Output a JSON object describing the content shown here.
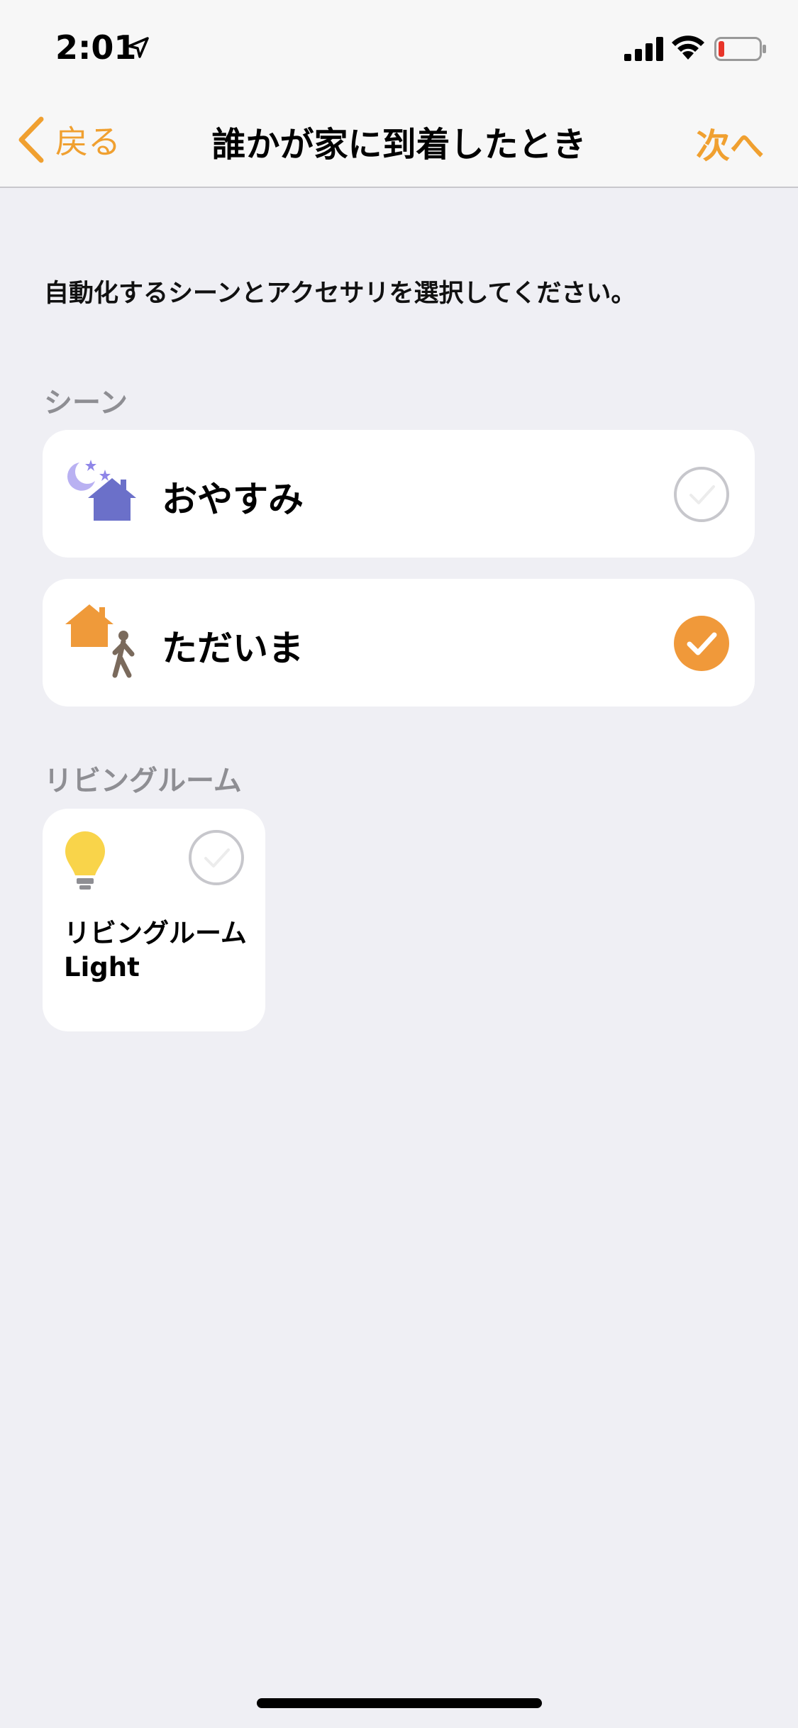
{
  "status_bar": {
    "time": "2:01",
    "icons": [
      "location-arrow-icon",
      "cellular-signal-icon",
      "wifi-icon",
      "battery-low-icon"
    ]
  },
  "nav": {
    "back_label": "戻る",
    "title": "誰かが家に到着したとき",
    "next_label": "次へ",
    "accent_color": "#f0a030"
  },
  "instruction": "自動化するシーンとアクセサリを選択してください。",
  "scenes": {
    "header": "シーン",
    "items": [
      {
        "label": "おやすみ",
        "icon": "goodnight-scene-icon",
        "selected": false
      },
      {
        "label": "ただいま",
        "icon": "arrive-home-scene-icon",
        "selected": true
      }
    ]
  },
  "rooms": {
    "header": "リビングルーム",
    "accessories": [
      {
        "name_line1": "リビングルーム",
        "name_line2": "Light",
        "icon": "lightbulb-icon",
        "selected": false
      }
    ]
  },
  "colors": {
    "selected_check": "#f0993a",
    "section_header": "#8e8e93",
    "background": "#efeff4"
  }
}
